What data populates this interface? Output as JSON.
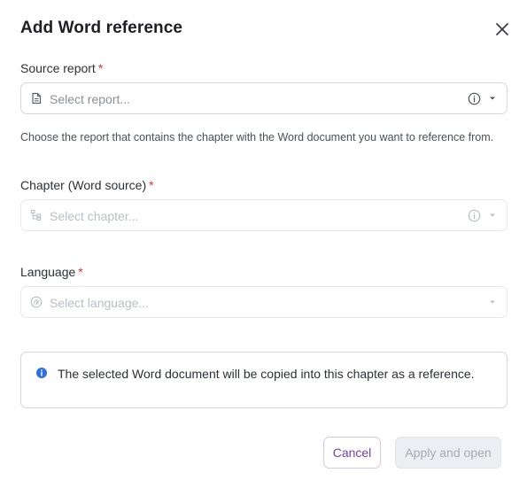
{
  "dialog": {
    "title": "Add Word reference",
    "close_icon": "close-icon"
  },
  "source_report": {
    "label": "Source report",
    "required_mark": "*",
    "placeholder": "Select report...",
    "lead_icon": "document-icon",
    "help_text": "Choose the report that contains the chapter with the Word document you want to reference from."
  },
  "chapter": {
    "label": "Chapter (Word source)",
    "required_mark": "*",
    "placeholder": "Select chapter...",
    "lead_icon": "tree-structure-icon"
  },
  "language": {
    "label": "Language",
    "required_mark": "*",
    "placeholder": "Select language...",
    "lead_icon": "language-icon"
  },
  "notice": {
    "text": "The selected Word document will be copied into this chapter as a reference.",
    "icon": "info-icon",
    "icon_color": "#2f6fde"
  },
  "footer": {
    "cancel_label": "Cancel",
    "apply_label": "Apply and open"
  },
  "colors": {
    "required": "#d93a2b",
    "cancel_text": "#6f3fb0",
    "border": "#d4d7dc"
  }
}
